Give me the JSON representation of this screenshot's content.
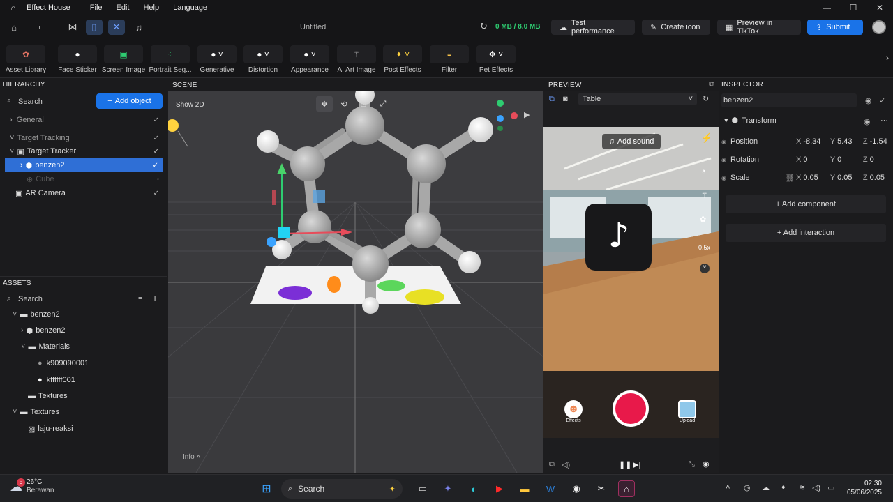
{
  "titlebar": {
    "app_name": "Effect House",
    "menus": [
      "File",
      "Edit",
      "Help",
      "Language"
    ]
  },
  "toolbar": {
    "project_title": "Untitled",
    "memory": "0 MB / 8.0 MB",
    "test_performance": "Test performance",
    "create_icon": "Create icon",
    "preview_tiktok": "Preview in TikTok",
    "submit": "Submit"
  },
  "tools": [
    "Asset Library",
    "Face Sticker",
    "Screen Image",
    "Portrait Seg...",
    "Generative",
    "Distortion",
    "Appearance",
    "AI Art Image",
    "Post Effects",
    "Filter",
    "Pet Effects"
  ],
  "hierarchy": {
    "header": "HIERARCHY",
    "search_placeholder": "Search",
    "add_object": "Add object",
    "items": [
      "General",
      "Target Tracking",
      "Target Tracker",
      "benzen2",
      "Cube",
      "AR Camera"
    ]
  },
  "assets": {
    "header": "ASSETS",
    "search_placeholder": "Search",
    "items": [
      "benzen2",
      "benzen2",
      "Materials",
      "k909090001",
      "kffffff001",
      "Textures",
      "Textures",
      "laju-reaksi"
    ]
  },
  "scene": {
    "header": "SCENE",
    "show2d": "Show 2D",
    "info": "Info"
  },
  "preview": {
    "header": "PREVIEW",
    "table_select": "Table",
    "add_sound": "Add sound",
    "zoom": "0.5x",
    "effects_label": "Effects",
    "upload_label": "Upload"
  },
  "inspector": {
    "header": "INSPECTOR",
    "object_name": "benzen2",
    "transform": "Transform",
    "position_label": "Position",
    "position": {
      "x": "-8.34",
      "y": "5.43",
      "z": "-1.54"
    },
    "rotation_label": "Rotation",
    "rotation": {
      "x": "0",
      "y": "0",
      "z": "0"
    },
    "scale_label": "Scale",
    "scale": {
      "x": "0.05",
      "y": "0.05",
      "z": "0.05"
    },
    "add_component": "+ Add component",
    "add_interaction": "+ Add interaction"
  },
  "taskbar": {
    "temperature": "26°C",
    "weather": "Berawan",
    "weather_badge": "5",
    "search": "Search",
    "time": "02:30",
    "date": "05/06/2025"
  },
  "colors": {
    "accent": "#1a73e8",
    "selected": "#2f6fd6",
    "memory_green": "#2ecc71",
    "record_red": "#e8194a"
  }
}
